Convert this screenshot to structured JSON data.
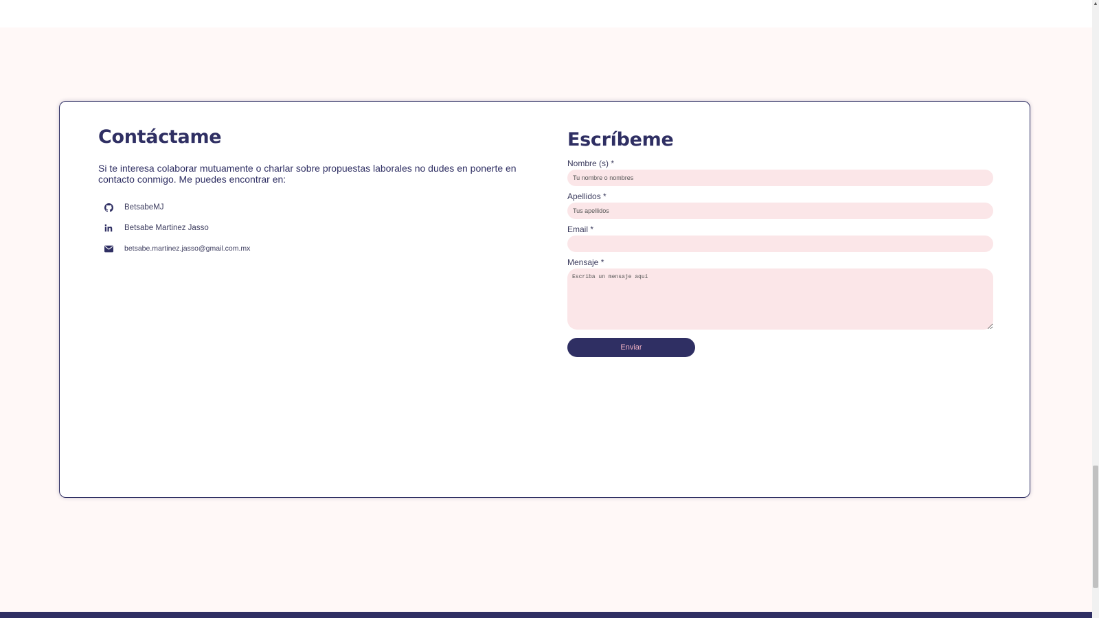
{
  "contact": {
    "title": "Contáctame",
    "intro": "Si te interesa colaborar mutuamente o charlar sobre propuestas laborales no dudes en ponerte en contacto conmigo. Me puedes encontrar en:",
    "links": [
      {
        "icon": "github-icon",
        "label": "BetsabeMJ"
      },
      {
        "icon": "linkedin-icon",
        "label": "Betsabe Martinez Jasso"
      },
      {
        "icon": "envelope-icon",
        "label": "betsabe.martinez.jasso@gmail.com.mx"
      }
    ]
  },
  "form": {
    "title": "Escríbeme",
    "fields": {
      "nombre": {
        "label": "Nombre (s) *",
        "placeholder": "Tu nombre o nombres",
        "value": ""
      },
      "apellidos": {
        "label": "Apellidos *",
        "placeholder": "Tus apellidos",
        "value": ""
      },
      "email": {
        "label": "Email *",
        "placeholder": "",
        "value": ""
      },
      "mensaje": {
        "label": "Mensaje *",
        "placeholder": "Escriba un mensaje aquí",
        "value": ""
      }
    },
    "submit_label": "Enviar"
  },
  "colors": {
    "primary": "#2f2f63",
    "field_bg": "#fbe6e8",
    "button_text": "#f2b3c4",
    "section_bg": "#fff8f7"
  }
}
